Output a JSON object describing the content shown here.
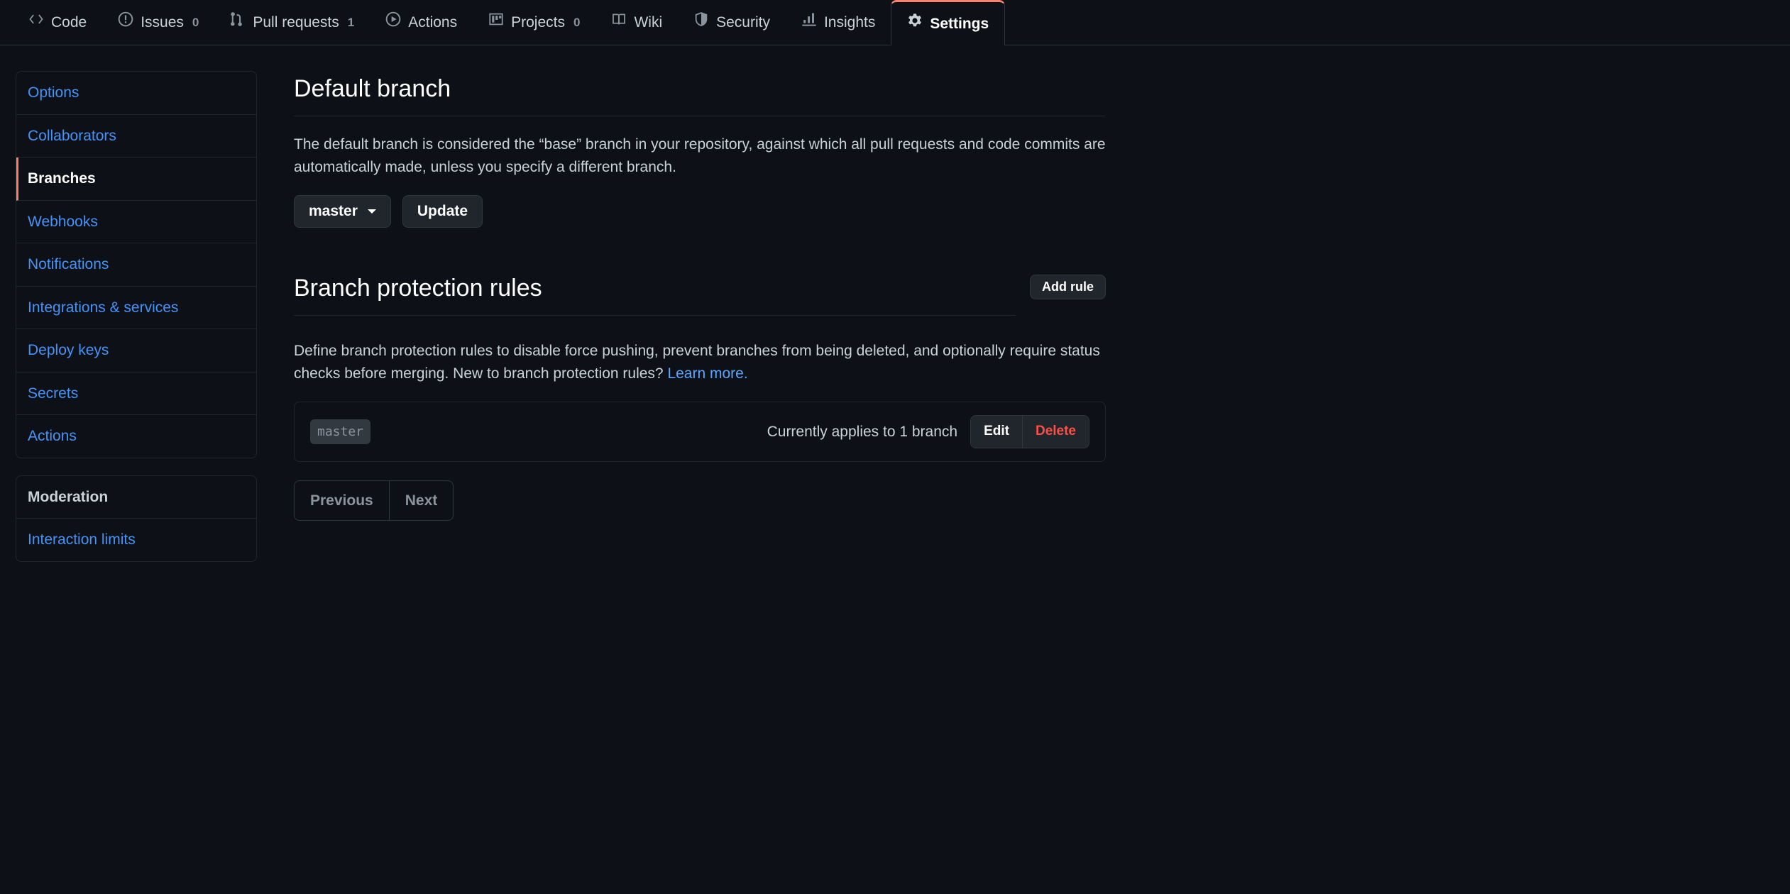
{
  "tabs": [
    {
      "id": "code",
      "label": "Code",
      "icon": "code"
    },
    {
      "id": "issues",
      "label": "Issues",
      "icon": "issue",
      "count": "0"
    },
    {
      "id": "pulls",
      "label": "Pull requests",
      "icon": "pr",
      "count": "1"
    },
    {
      "id": "actions",
      "label": "Actions",
      "icon": "play"
    },
    {
      "id": "projects",
      "label": "Projects",
      "icon": "project",
      "count": "0"
    },
    {
      "id": "wiki",
      "label": "Wiki",
      "icon": "book"
    },
    {
      "id": "security",
      "label": "Security",
      "icon": "shield"
    },
    {
      "id": "insights",
      "label": "Insights",
      "icon": "graph"
    },
    {
      "id": "settings",
      "label": "Settings",
      "icon": "gear",
      "active": true
    }
  ],
  "side_main": [
    {
      "label": "Options"
    },
    {
      "label": "Collaborators"
    },
    {
      "label": "Branches",
      "selected": true
    },
    {
      "label": "Webhooks"
    },
    {
      "label": "Notifications"
    },
    {
      "label": "Integrations & services"
    },
    {
      "label": "Deploy keys"
    },
    {
      "label": "Secrets"
    },
    {
      "label": "Actions"
    }
  ],
  "side_mod_header": "Moderation",
  "side_mod": [
    {
      "label": "Interaction limits"
    }
  ],
  "default_branch": {
    "title": "Default branch",
    "description": "The default branch is considered the “base” branch in your repository, against which all pull requests and code commits are automatically made, unless you specify a different branch.",
    "selector_value": "master",
    "update_label": "Update"
  },
  "protection": {
    "title": "Branch protection rules",
    "add_label": "Add rule",
    "description_prefix": "Define branch protection rules to disable force pushing, prevent branches from being deleted, and optionally require status checks before merging. New to branch protection rules? ",
    "learn_more": "Learn more.",
    "rule": {
      "pattern": "master",
      "applies_text": "Currently applies to 1 branch",
      "edit_label": "Edit",
      "delete_label": "Delete"
    },
    "pager": {
      "prev": "Previous",
      "next": "Next"
    }
  }
}
